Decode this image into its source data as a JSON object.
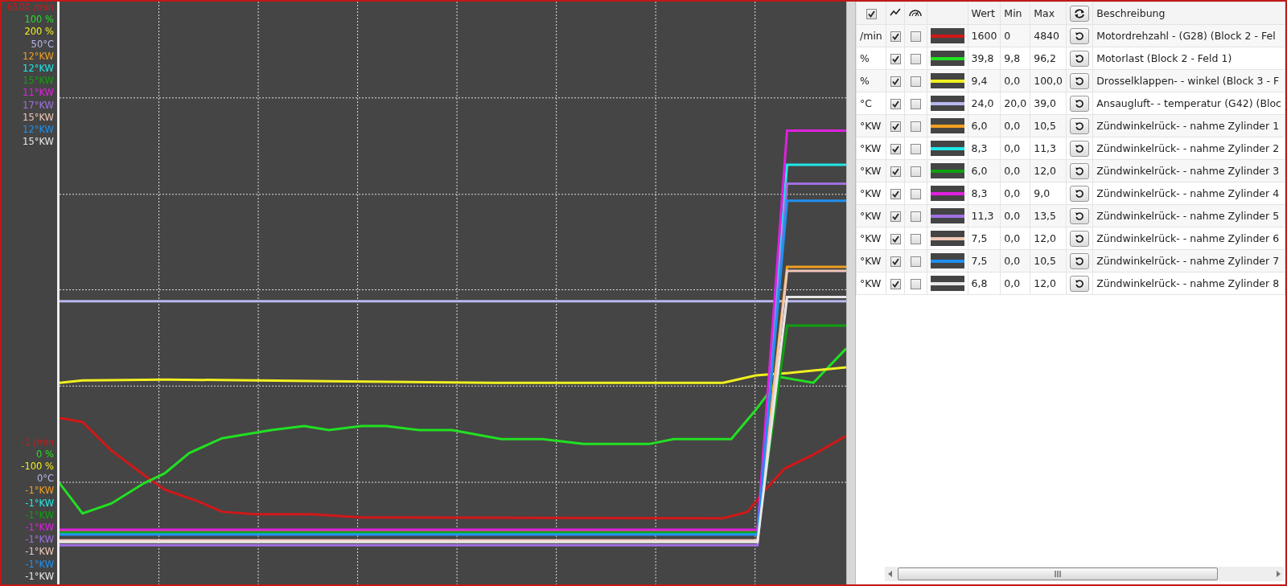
{
  "table": {
    "header": {
      "all_checked": true,
      "columns": [
        "Wert",
        "Min",
        "Max",
        "Beschreibung"
      ]
    },
    "rows": [
      {
        "unit": "/min",
        "shown": true,
        "gauge": false,
        "color": "#d01818",
        "value": "1600",
        "min": "0",
        "max": "4840",
        "description": "Motordrehzahl - (G28) (Block 2 - Fel",
        "axis_max": "6500 /min",
        "axis_min": "-1 /min"
      },
      {
        "unit": "%",
        "shown": true,
        "gauge": false,
        "color": "#22e022",
        "value": "39,8",
        "min": "9,8",
        "max": "96,2",
        "description": "Motorlast (Block 2 - Feld 1)",
        "axis_max": "100 %",
        "axis_min": "0 %"
      },
      {
        "unit": "%",
        "shown": true,
        "gauge": false,
        "color": "#f0f020",
        "value": "9,4",
        "min": "0,0",
        "max": "100,0",
        "description": "Drosselklappen- - winkel (Block 3 - F",
        "axis_max": "200 %",
        "axis_min": "-100 %"
      },
      {
        "unit": "°C",
        "shown": true,
        "gauge": false,
        "color": "#b8b8f0",
        "value": "24,0",
        "min": "20,0",
        "max": "39,0",
        "description": "Ansaugluft- - temperatur (G42) (Bloc",
        "axis_max": "50°C",
        "axis_min": "0°C"
      },
      {
        "unit": "°KW",
        "shown": true,
        "gauge": false,
        "color": "#f0a020",
        "value": "6,0",
        "min": "0,0",
        "max": "10,5",
        "description": "Zündwinkelrück- - nahme Zylinder 1",
        "axis_max": "12°KW",
        "axis_min": "-1°KW"
      },
      {
        "unit": "°KW",
        "shown": true,
        "gauge": false,
        "color": "#20e8e8",
        "value": "8,3",
        "min": "0,0",
        "max": "11,3",
        "description": "Zündwinkelrück- - nahme Zylinder 2",
        "axis_max": "12°KW",
        "axis_min": "-1°KW"
      },
      {
        "unit": "°KW",
        "shown": true,
        "gauge": false,
        "color": "#10a010",
        "value": "6,0",
        "min": "0,0",
        "max": "12,0",
        "description": "Zündwinkelrück- - nahme Zylinder 3",
        "axis_max": "15°KW",
        "axis_min": "-1°KW"
      },
      {
        "unit": "°KW",
        "shown": true,
        "gauge": false,
        "color": "#e020e0",
        "value": "8,3",
        "min": "0,0",
        "max": "9,0",
        "description": "Zündwinkelrück- - nahme Zylinder 4",
        "axis_max": "11°KW",
        "axis_min": "-1°KW"
      },
      {
        "unit": "°KW",
        "shown": true,
        "gauge": false,
        "color": "#a070e0",
        "value": "11,3",
        "min": "0,0",
        "max": "13,5",
        "description": "Zündwinkelrück- - nahme Zylinder 5",
        "axis_max": "17°KW",
        "axis_min": "-1°KW"
      },
      {
        "unit": "°KW",
        "shown": true,
        "gauge": false,
        "color": "#f0c8b8",
        "value": "7,5",
        "min": "0,0",
        "max": "12,0",
        "description": "Zündwinkelrück- - nahme Zylinder 6",
        "axis_max": "15°KW",
        "axis_min": "-1°KW"
      },
      {
        "unit": "°KW",
        "shown": true,
        "gauge": false,
        "color": "#2090f0",
        "value": "7,5",
        "min": "0,0",
        "max": "10,5",
        "description": "Zündwinkelrück- - nahme Zylinder 7",
        "axis_max": "12°KW",
        "axis_min": "-1°KW"
      },
      {
        "unit": "°KW",
        "shown": true,
        "gauge": false,
        "color": "#e8e8e8",
        "value": "6,8",
        "min": "0,0",
        "max": "12,0",
        "description": "Zündwinkelrück- - nahme Zylinder 8",
        "axis_max": "15°KW",
        "axis_min": "-1°KW"
      }
    ]
  }
}
